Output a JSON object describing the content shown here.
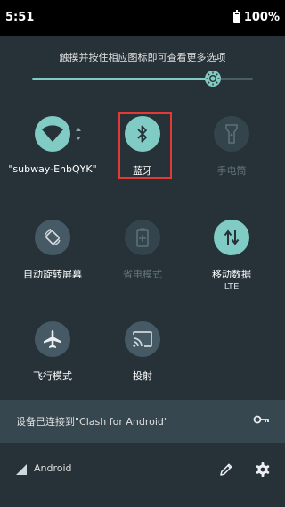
{
  "status_bar": {
    "time": "5:51",
    "battery": "100%"
  },
  "brightness": {
    "hint": "触摸并按住相应图标即可查看更多选项",
    "level_percent": 82
  },
  "tiles": {
    "wifi": {
      "label": "\"subway-EnbQYK\"",
      "state": "on",
      "icon": "wifi-icon"
    },
    "bluetooth": {
      "label": "蓝牙",
      "state": "on",
      "icon": "bluetooth-icon"
    },
    "flashlight": {
      "label": "手电筒",
      "state": "disabled",
      "icon": "flashlight-icon"
    },
    "rotate": {
      "label": "自动旋转屏幕",
      "state": "off",
      "icon": "auto-rotate-icon"
    },
    "battery_saver": {
      "label": "省电模式",
      "state": "disabled",
      "icon": "battery-saver-icon"
    },
    "mobile_data": {
      "label": "移动数据",
      "sub": "LTE",
      "state": "on",
      "icon": "mobile-data-icon"
    },
    "airplane": {
      "label": "飞行模式",
      "state": "off",
      "icon": "airplane-icon"
    },
    "cast": {
      "label": "投射",
      "state": "off",
      "icon": "cast-icon"
    }
  },
  "vpn": {
    "text": "设备已连接到\"Clash for Android\"",
    "icon": "key-icon"
  },
  "bottom": {
    "carrier": "Android",
    "edit_icon": "pencil-icon",
    "settings_icon": "gear-icon"
  },
  "colors": {
    "accent": "#80cbc4",
    "panel_bg": "#263238",
    "highlight": "#e53935"
  }
}
